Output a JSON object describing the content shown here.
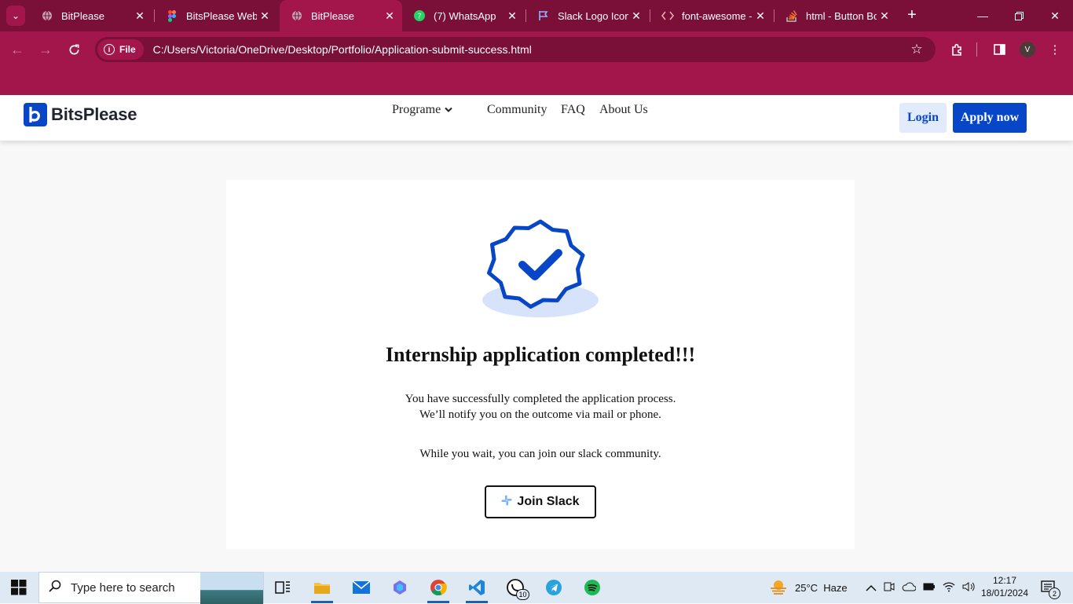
{
  "browser": {
    "tabs": [
      {
        "title": "BitPlease",
        "active": false
      },
      {
        "title": "BitsPlease Web A",
        "active": false
      },
      {
        "title": "BitPlease",
        "active": true
      },
      {
        "title": "(7) WhatsApp",
        "active": false
      },
      {
        "title": "Slack Logo Icon",
        "active": false
      },
      {
        "title": "font-awesome -",
        "active": false
      },
      {
        "title": "html - Button Bo",
        "active": false
      }
    ],
    "chip_label": "File",
    "url": "C:/Users/Victoria/OneDrive/Desktop/Portfolio/Application-submit-success.html",
    "profile_initial": "V",
    "colors": {
      "frame": "#a3164c",
      "tabstrip": "#7a0f38"
    }
  },
  "site": {
    "brand": "BitsPlease",
    "nav": {
      "programe": "Programe",
      "community": "Community",
      "faq": "FAQ",
      "about": "About Us"
    },
    "login_label": "Login",
    "apply_label": "Apply now",
    "accent": "#0747c7"
  },
  "card": {
    "heading": "Internship application completed!!!",
    "line1": "You have successfully completed the application process.",
    "line2": "We’ll notify you on the outcome via mail or phone.",
    "line3": "While you wait, you can join our slack community.",
    "slack_button": "Join Slack"
  },
  "taskbar": {
    "search_placeholder": "Type here to search",
    "whatsapp_badge": "10",
    "weather": "25°C  Haze",
    "time": "12:17",
    "date": "18/01/2024",
    "notifications": "2"
  }
}
